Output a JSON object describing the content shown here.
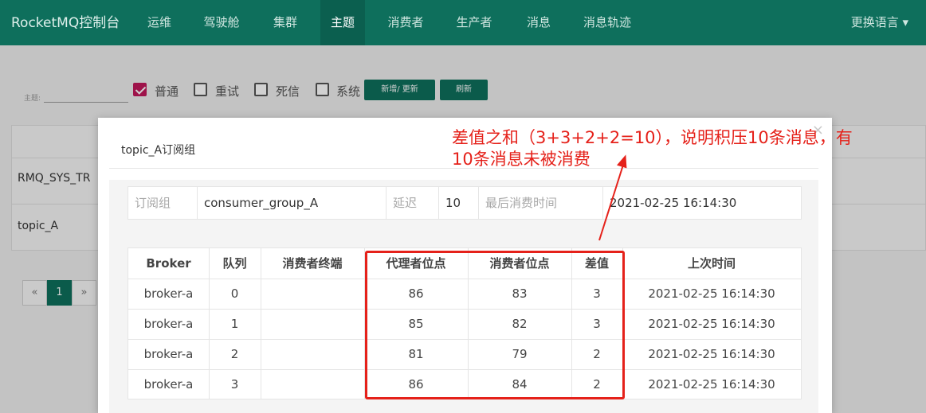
{
  "navbar": {
    "brand": "RocketMQ控制台",
    "items": [
      "运维",
      "驾驶舱",
      "集群",
      "主题",
      "消费者",
      "生产者",
      "消息",
      "消息轨迹"
    ],
    "active_index": 3,
    "language": "更换语言 ▾"
  },
  "filters": {
    "topic_label": "主题:",
    "checkboxes": [
      {
        "label": "普通",
        "checked": true
      },
      {
        "label": "重试",
        "checked": false
      },
      {
        "label": "死信",
        "checked": false
      },
      {
        "label": "系统",
        "checked": false
      }
    ],
    "add_update_button": "新增/ 更新",
    "refresh_button": "刷新"
  },
  "background_table": {
    "rows": [
      "RMQ_SYS_TR",
      "topic_A"
    ]
  },
  "pagination": {
    "prev": "«",
    "current": "1",
    "next": "»"
  },
  "modal": {
    "title": "topic_A订阅组",
    "close": "×",
    "info": {
      "group_label": "订阅组",
      "group_value": "consumer_group_A",
      "delay_label": "延迟",
      "delay_value": "10",
      "last_consume_label": "最后消费时间",
      "last_consume_value": "2021-02-25 16:14:30"
    },
    "queue_table": {
      "headers": [
        "Broker",
        "队列",
        "消费者终端",
        "代理者位点",
        "消费者位点",
        "差值",
        "上次时间"
      ],
      "rows": [
        {
          "broker": "broker-a",
          "queue": "0",
          "client": "",
          "broker_offset": "86",
          "consumer_offset": "83",
          "diff": "3",
          "time": "2021-02-25 16:14:30"
        },
        {
          "broker": "broker-a",
          "queue": "1",
          "client": "",
          "broker_offset": "85",
          "consumer_offset": "82",
          "diff": "3",
          "time": "2021-02-25 16:14:30"
        },
        {
          "broker": "broker-a",
          "queue": "2",
          "client": "",
          "broker_offset": "81",
          "consumer_offset": "79",
          "diff": "2",
          "time": "2021-02-25 16:14:30"
        },
        {
          "broker": "broker-a",
          "queue": "3",
          "client": "",
          "broker_offset": "86",
          "consumer_offset": "84",
          "diff": "2",
          "time": "2021-02-25 16:14:30"
        }
      ]
    }
  },
  "annotation": {
    "line1": "差值之和（3+3+2+2=10），说明积压10条消息，有",
    "line2": "10条消息未被消费",
    "color": "#e5211a"
  }
}
